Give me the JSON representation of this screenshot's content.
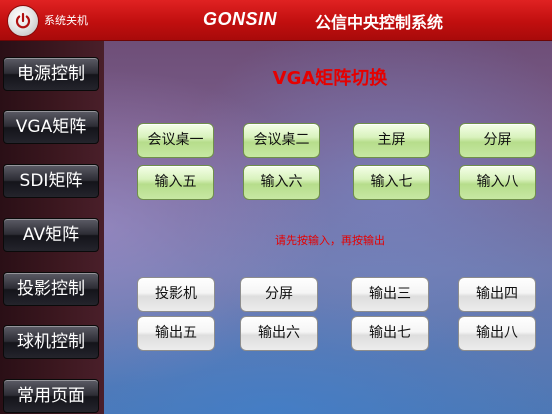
{
  "header": {
    "shutdown_label": "系统关机",
    "brand": "GONSIN",
    "brand_sub": "公信中央控制系统",
    "power_icon": "power-icon"
  },
  "sidebar": {
    "items": [
      {
        "label": "电源控制"
      },
      {
        "label": "VGA矩阵"
      },
      {
        "label": "SDI矩阵"
      },
      {
        "label": "AV矩阵"
      },
      {
        "label": "投影控制"
      },
      {
        "label": "球机控制"
      },
      {
        "label": "常用页面"
      }
    ]
  },
  "main": {
    "title": "VGA矩阵切换",
    "inputs": [
      {
        "label": "会议桌一"
      },
      {
        "label": "会议桌二"
      },
      {
        "label": "主屏"
      },
      {
        "label": "分屏"
      },
      {
        "label": "输入五"
      },
      {
        "label": "输入六"
      },
      {
        "label": "输入七"
      },
      {
        "label": "输入八"
      }
    ],
    "hint": "请先按输入，再按输出",
    "outputs": [
      {
        "label": "投影机"
      },
      {
        "label": "分屏"
      },
      {
        "label": "输出三"
      },
      {
        "label": "输出四"
      },
      {
        "label": "输出五"
      },
      {
        "label": "输出六"
      },
      {
        "label": "输出七"
      },
      {
        "label": "输出八"
      }
    ]
  },
  "colors": {
    "header_red": "#c10f0f",
    "title_red": "#e60000",
    "input_green": "#c7e8a3",
    "output_white": "#ececec"
  }
}
